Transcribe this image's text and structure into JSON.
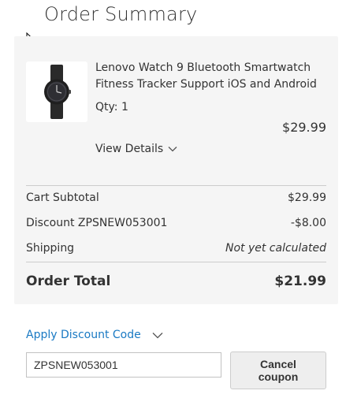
{
  "summary": {
    "title": "Order Summary"
  },
  "item": {
    "name": "Lenovo Watch 9 Bluetooth Smartwatch Fitness Tracker Support iOS and Android",
    "qty_label": "Qty: 1",
    "price": "$29.99",
    "view_details_label": "View Details",
    "thumbnail_icon": "smartwatch-product-image"
  },
  "totals": {
    "subtotal_label": "Cart Subtotal",
    "subtotal_value": "$29.99",
    "discount_label": "Discount ZPSNEW053001",
    "discount_value": "-$8.00",
    "shipping_label": "Shipping",
    "shipping_value": "Not yet calculated",
    "order_total_label": "Order Total",
    "order_total_value": "$21.99"
  },
  "discount": {
    "toggle_label": "Apply Discount Code",
    "code_value": "ZPSNEW053001",
    "cancel_label": "Cancel coupon"
  },
  "colors": {
    "link": "#1979c3",
    "panel_bg": "#f5f5f5",
    "text": "#333333"
  }
}
